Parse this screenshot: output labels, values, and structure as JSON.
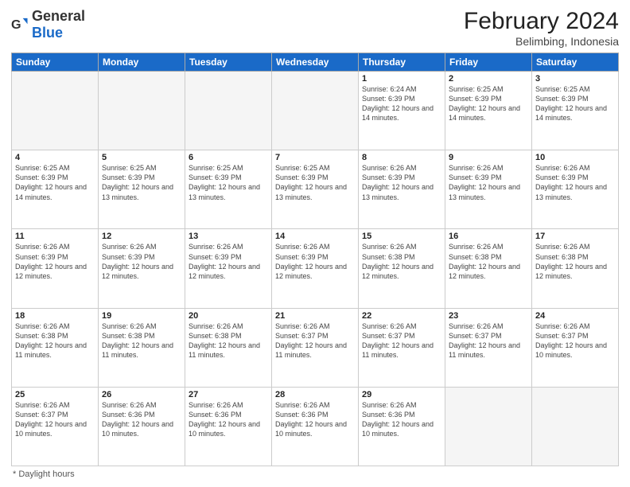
{
  "header": {
    "logo_general": "General",
    "logo_blue": "Blue",
    "month_year": "February 2024",
    "location": "Belimbing, Indonesia"
  },
  "days_of_week": [
    "Sunday",
    "Monday",
    "Tuesday",
    "Wednesday",
    "Thursday",
    "Friday",
    "Saturday"
  ],
  "weeks": [
    [
      {
        "day": "",
        "empty": true
      },
      {
        "day": "",
        "empty": true
      },
      {
        "day": "",
        "empty": true
      },
      {
        "day": "",
        "empty": true
      },
      {
        "day": "1",
        "sunrise": "6:24 AM",
        "sunset": "6:39 PM",
        "daylight": "12 hours and 14 minutes."
      },
      {
        "day": "2",
        "sunrise": "6:25 AM",
        "sunset": "6:39 PM",
        "daylight": "12 hours and 14 minutes."
      },
      {
        "day": "3",
        "sunrise": "6:25 AM",
        "sunset": "6:39 PM",
        "daylight": "12 hours and 14 minutes."
      }
    ],
    [
      {
        "day": "4",
        "sunrise": "6:25 AM",
        "sunset": "6:39 PM",
        "daylight": "12 hours and 14 minutes."
      },
      {
        "day": "5",
        "sunrise": "6:25 AM",
        "sunset": "6:39 PM",
        "daylight": "12 hours and 13 minutes."
      },
      {
        "day": "6",
        "sunrise": "6:25 AM",
        "sunset": "6:39 PM",
        "daylight": "12 hours and 13 minutes."
      },
      {
        "day": "7",
        "sunrise": "6:25 AM",
        "sunset": "6:39 PM",
        "daylight": "12 hours and 13 minutes."
      },
      {
        "day": "8",
        "sunrise": "6:26 AM",
        "sunset": "6:39 PM",
        "daylight": "12 hours and 13 minutes."
      },
      {
        "day": "9",
        "sunrise": "6:26 AM",
        "sunset": "6:39 PM",
        "daylight": "12 hours and 13 minutes."
      },
      {
        "day": "10",
        "sunrise": "6:26 AM",
        "sunset": "6:39 PM",
        "daylight": "12 hours and 13 minutes."
      }
    ],
    [
      {
        "day": "11",
        "sunrise": "6:26 AM",
        "sunset": "6:39 PM",
        "daylight": "12 hours and 12 minutes."
      },
      {
        "day": "12",
        "sunrise": "6:26 AM",
        "sunset": "6:39 PM",
        "daylight": "12 hours and 12 minutes."
      },
      {
        "day": "13",
        "sunrise": "6:26 AM",
        "sunset": "6:39 PM",
        "daylight": "12 hours and 12 minutes."
      },
      {
        "day": "14",
        "sunrise": "6:26 AM",
        "sunset": "6:39 PM",
        "daylight": "12 hours and 12 minutes."
      },
      {
        "day": "15",
        "sunrise": "6:26 AM",
        "sunset": "6:38 PM",
        "daylight": "12 hours and 12 minutes."
      },
      {
        "day": "16",
        "sunrise": "6:26 AM",
        "sunset": "6:38 PM",
        "daylight": "12 hours and 12 minutes."
      },
      {
        "day": "17",
        "sunrise": "6:26 AM",
        "sunset": "6:38 PM",
        "daylight": "12 hours and 12 minutes."
      }
    ],
    [
      {
        "day": "18",
        "sunrise": "6:26 AM",
        "sunset": "6:38 PM",
        "daylight": "12 hours and 11 minutes."
      },
      {
        "day": "19",
        "sunrise": "6:26 AM",
        "sunset": "6:38 PM",
        "daylight": "12 hours and 11 minutes."
      },
      {
        "day": "20",
        "sunrise": "6:26 AM",
        "sunset": "6:38 PM",
        "daylight": "12 hours and 11 minutes."
      },
      {
        "day": "21",
        "sunrise": "6:26 AM",
        "sunset": "6:37 PM",
        "daylight": "12 hours and 11 minutes."
      },
      {
        "day": "22",
        "sunrise": "6:26 AM",
        "sunset": "6:37 PM",
        "daylight": "12 hours and 11 minutes."
      },
      {
        "day": "23",
        "sunrise": "6:26 AM",
        "sunset": "6:37 PM",
        "daylight": "12 hours and 11 minutes."
      },
      {
        "day": "24",
        "sunrise": "6:26 AM",
        "sunset": "6:37 PM",
        "daylight": "12 hours and 10 minutes."
      }
    ],
    [
      {
        "day": "25",
        "sunrise": "6:26 AM",
        "sunset": "6:37 PM",
        "daylight": "12 hours and 10 minutes."
      },
      {
        "day": "26",
        "sunrise": "6:26 AM",
        "sunset": "6:36 PM",
        "daylight": "12 hours and 10 minutes."
      },
      {
        "day": "27",
        "sunrise": "6:26 AM",
        "sunset": "6:36 PM",
        "daylight": "12 hours and 10 minutes."
      },
      {
        "day": "28",
        "sunrise": "6:26 AM",
        "sunset": "6:36 PM",
        "daylight": "12 hours and 10 minutes."
      },
      {
        "day": "29",
        "sunrise": "6:26 AM",
        "sunset": "6:36 PM",
        "daylight": "12 hours and 10 minutes."
      },
      {
        "day": "",
        "empty": true
      },
      {
        "day": "",
        "empty": true
      }
    ]
  ],
  "footer": {
    "daylight_label": "Daylight hours"
  }
}
